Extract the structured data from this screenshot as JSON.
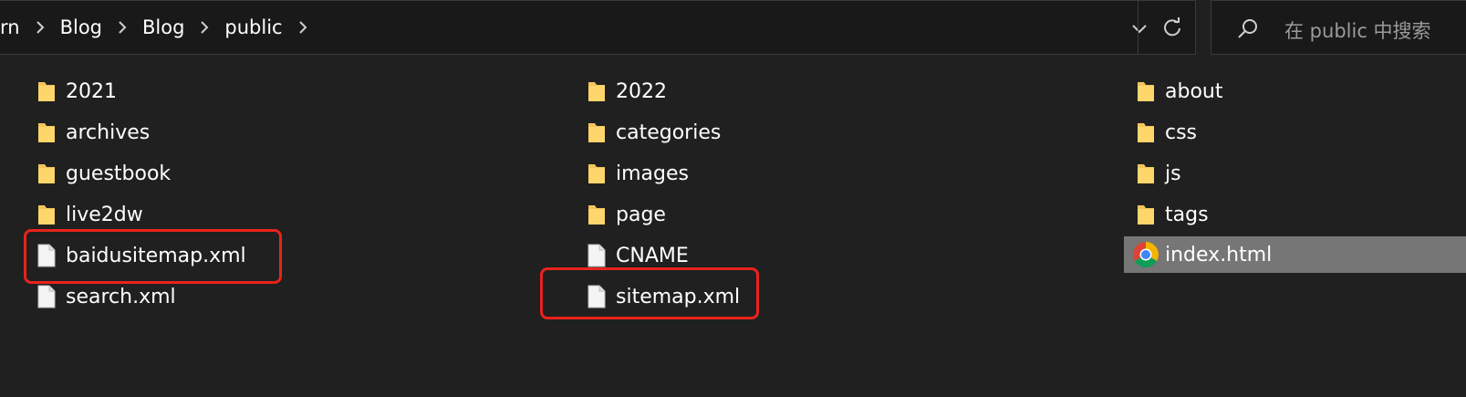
{
  "address_bar": {
    "breadcrumbs": [
      "rn",
      "Blog",
      "Blog",
      "public"
    ]
  },
  "search": {
    "placeholder": "在 public 中搜索"
  },
  "files": {
    "column1": [
      {
        "name": "2021",
        "type": "folder"
      },
      {
        "name": "archives",
        "type": "folder"
      },
      {
        "name": "guestbook",
        "type": "folder"
      },
      {
        "name": "live2dw",
        "type": "folder"
      },
      {
        "name": "baidusitemap.xml",
        "type": "file",
        "highlighted": true
      },
      {
        "name": "search.xml",
        "type": "file"
      }
    ],
    "column2": [
      {
        "name": "2022",
        "type": "folder"
      },
      {
        "name": "categories",
        "type": "folder"
      },
      {
        "name": "images",
        "type": "folder"
      },
      {
        "name": "page",
        "type": "folder"
      },
      {
        "name": "CNAME",
        "type": "file"
      },
      {
        "name": "sitemap.xml",
        "type": "file",
        "highlighted": true
      }
    ],
    "column3": [
      {
        "name": "about",
        "type": "folder"
      },
      {
        "name": "css",
        "type": "folder"
      },
      {
        "name": "js",
        "type": "folder"
      },
      {
        "name": "tags",
        "type": "folder"
      },
      {
        "name": "index.html",
        "type": "chrome-html",
        "selected": true
      }
    ]
  },
  "colors": {
    "background": "#202020",
    "highlight_border": "#e8231c",
    "selection": "#767676",
    "folder": "#f2c55c"
  }
}
